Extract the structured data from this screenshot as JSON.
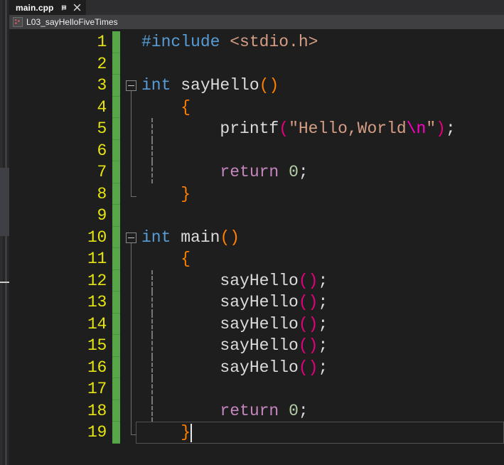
{
  "window": {
    "editor_background": "#1e1e1e",
    "chrome_background": "#2d2d30"
  },
  "tab": {
    "label": "main.cpp",
    "pin_icon": "pin-icon",
    "close_icon": "close-icon"
  },
  "navbar": {
    "project_icon": "cpp-project-icon",
    "label": "L03_sayHelloFiveTimes"
  },
  "editor": {
    "language": "C++",
    "caret_line": 19,
    "caret_column": 2,
    "line_number_color": "#e5e510",
    "change_bar_color": "#57a64a",
    "lines": [
      {
        "n": "1",
        "changed": true,
        "collapse": false,
        "outline": "none",
        "indent_guide": false,
        "current": false,
        "tokens": [
          {
            "t": "#include",
            "c": "t-includedir"
          },
          {
            "t": " ",
            "c": "t-plain"
          },
          {
            "t": "<stdio.h>",
            "c": "t-header"
          }
        ]
      },
      {
        "n": "2",
        "changed": true,
        "collapse": false,
        "outline": "none",
        "indent_guide": false,
        "current": false,
        "tokens": []
      },
      {
        "n": "3",
        "changed": true,
        "collapse": true,
        "outline": "start",
        "indent_guide": false,
        "current": false,
        "tokens": [
          {
            "t": "int",
            "c": "t-keyword"
          },
          {
            "t": " sayHello",
            "c": "t-plain"
          },
          {
            "t": "()",
            "c": "t-paren-o"
          }
        ]
      },
      {
        "n": "4",
        "changed": true,
        "collapse": false,
        "outline": "mid",
        "indent_guide": false,
        "current": false,
        "tokens": [
          {
            "t": "    ",
            "c": "t-plain"
          },
          {
            "t": "{",
            "c": "t-brace"
          }
        ]
      },
      {
        "n": "5",
        "changed": true,
        "collapse": false,
        "outline": "mid",
        "indent_guide": true,
        "current": false,
        "tokens": [
          {
            "t": "        ",
            "c": "t-plain"
          },
          {
            "t": "printf",
            "c": "t-plain"
          },
          {
            "t": "(",
            "c": "t-paren-m"
          },
          {
            "t": "\"Hello,World",
            "c": "t-string"
          },
          {
            "t": "\\n",
            "c": "t-escape"
          },
          {
            "t": "\"",
            "c": "t-string"
          },
          {
            "t": ")",
            "c": "t-paren-m"
          },
          {
            "t": ";",
            "c": "t-punct"
          }
        ]
      },
      {
        "n": "6",
        "changed": true,
        "collapse": false,
        "outline": "mid",
        "indent_guide": true,
        "current": false,
        "tokens": []
      },
      {
        "n": "7",
        "changed": true,
        "collapse": false,
        "outline": "mid",
        "indent_guide": true,
        "current": false,
        "tokens": [
          {
            "t": "        ",
            "c": "t-plain"
          },
          {
            "t": "return",
            "c": "t-ctrl"
          },
          {
            "t": " ",
            "c": "t-plain"
          },
          {
            "t": "0",
            "c": "t-number"
          },
          {
            "t": ";",
            "c": "t-punct"
          }
        ]
      },
      {
        "n": "8",
        "changed": true,
        "collapse": false,
        "outline": "end",
        "indent_guide": false,
        "current": false,
        "tokens": [
          {
            "t": "    ",
            "c": "t-plain"
          },
          {
            "t": "}",
            "c": "t-brace"
          }
        ]
      },
      {
        "n": "9",
        "changed": true,
        "collapse": false,
        "outline": "none",
        "indent_guide": false,
        "current": false,
        "tokens": []
      },
      {
        "n": "10",
        "changed": true,
        "collapse": true,
        "outline": "start",
        "indent_guide": false,
        "current": false,
        "tokens": [
          {
            "t": "int",
            "c": "t-keyword"
          },
          {
            "t": " main",
            "c": "t-plain"
          },
          {
            "t": "()",
            "c": "t-paren-o"
          }
        ]
      },
      {
        "n": "11",
        "changed": true,
        "collapse": false,
        "outline": "mid",
        "indent_guide": false,
        "current": false,
        "tokens": [
          {
            "t": "    ",
            "c": "t-plain"
          },
          {
            "t": "{",
            "c": "t-brace"
          }
        ]
      },
      {
        "n": "12",
        "changed": true,
        "collapse": false,
        "outline": "mid",
        "indent_guide": true,
        "current": false,
        "tokens": [
          {
            "t": "        ",
            "c": "t-plain"
          },
          {
            "t": "sayHello",
            "c": "t-plain"
          },
          {
            "t": "()",
            "c": "t-paren-m"
          },
          {
            "t": ";",
            "c": "t-punct"
          }
        ]
      },
      {
        "n": "13",
        "changed": true,
        "collapse": false,
        "outline": "mid",
        "indent_guide": true,
        "current": false,
        "tokens": [
          {
            "t": "        ",
            "c": "t-plain"
          },
          {
            "t": "sayHello",
            "c": "t-plain"
          },
          {
            "t": "()",
            "c": "t-paren-m"
          },
          {
            "t": ";",
            "c": "t-punct"
          }
        ]
      },
      {
        "n": "14",
        "changed": true,
        "collapse": false,
        "outline": "mid",
        "indent_guide": true,
        "current": false,
        "tokens": [
          {
            "t": "        ",
            "c": "t-plain"
          },
          {
            "t": "sayHello",
            "c": "t-plain"
          },
          {
            "t": "()",
            "c": "t-paren-m"
          },
          {
            "t": ";",
            "c": "t-punct"
          }
        ]
      },
      {
        "n": "15",
        "changed": true,
        "collapse": false,
        "outline": "mid",
        "indent_guide": true,
        "current": false,
        "tokens": [
          {
            "t": "        ",
            "c": "t-plain"
          },
          {
            "t": "sayHello",
            "c": "t-plain"
          },
          {
            "t": "()",
            "c": "t-paren-m"
          },
          {
            "t": ";",
            "c": "t-punct"
          }
        ]
      },
      {
        "n": "16",
        "changed": true,
        "collapse": false,
        "outline": "mid",
        "indent_guide": true,
        "current": false,
        "tokens": [
          {
            "t": "        ",
            "c": "t-plain"
          },
          {
            "t": "sayHello",
            "c": "t-plain"
          },
          {
            "t": "()",
            "c": "t-paren-m"
          },
          {
            "t": ";",
            "c": "t-punct"
          }
        ]
      },
      {
        "n": "17",
        "changed": true,
        "collapse": false,
        "outline": "mid",
        "indent_guide": true,
        "current": false,
        "tokens": []
      },
      {
        "n": "18",
        "changed": true,
        "collapse": false,
        "outline": "mid",
        "indent_guide": true,
        "current": false,
        "tokens": [
          {
            "t": "        ",
            "c": "t-plain"
          },
          {
            "t": "return",
            "c": "t-ctrl"
          },
          {
            "t": " ",
            "c": "t-plain"
          },
          {
            "t": "0",
            "c": "t-number"
          },
          {
            "t": ";",
            "c": "t-punct"
          }
        ]
      },
      {
        "n": "19",
        "changed": true,
        "collapse": false,
        "outline": "end",
        "indent_guide": false,
        "current": true,
        "caret_after_chars": 5,
        "tokens": [
          {
            "t": "    ",
            "c": "t-plain"
          },
          {
            "t": "}",
            "c": "t-brace"
          }
        ]
      }
    ]
  }
}
